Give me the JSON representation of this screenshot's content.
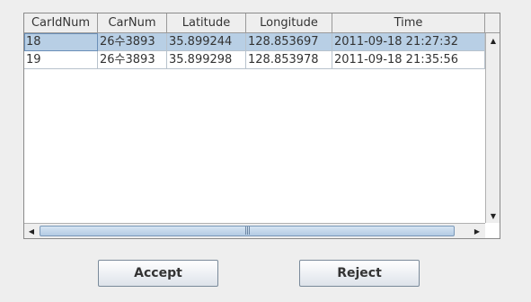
{
  "table": {
    "columns": [
      "CarIdNum",
      "CarNum",
      "Latitude",
      "Longitude",
      "Time"
    ],
    "rows": [
      [
        "18",
        "26수3893",
        "35.899244",
        "128.853697",
        "2011-09-18 21:27:32"
      ],
      [
        "19",
        "26수3893",
        "35.899298",
        "128.853978",
        "2011-09-18 21:35:56"
      ]
    ],
    "selected_row": 0
  },
  "buttons": {
    "accept_label": "Accept",
    "reject_label": "Reject"
  },
  "icons": {
    "scroll_up": "arrow-up-icon",
    "scroll_down": "arrow-down-icon",
    "scroll_left": "arrow-left-icon",
    "scroll_right": "arrow-right-icon"
  },
  "colors": {
    "selection": "#b8cfe5",
    "background": "#eeeeee"
  }
}
